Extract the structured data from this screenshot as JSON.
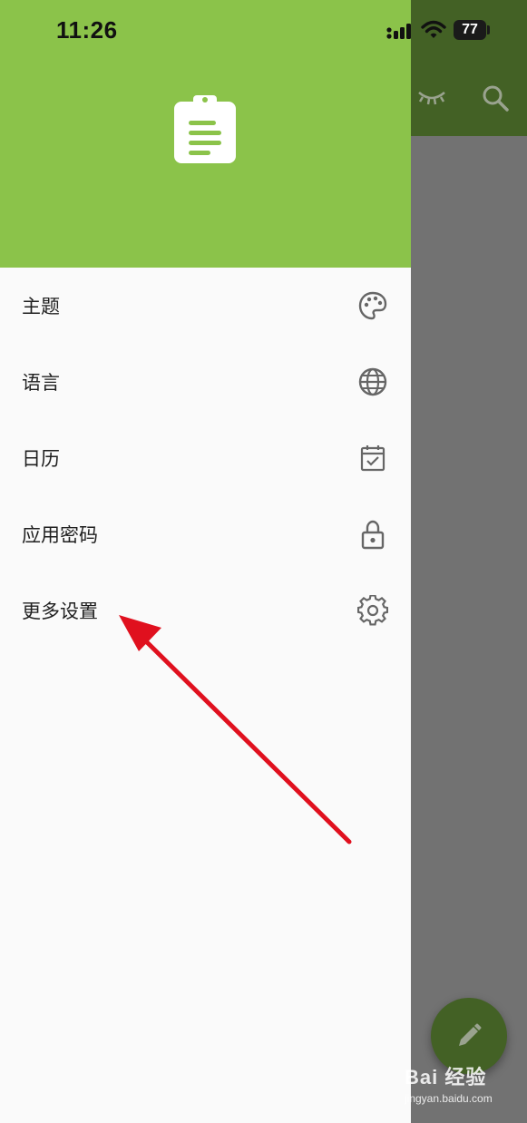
{
  "status_bar": {
    "time": "11:26",
    "battery": "77"
  },
  "menu": {
    "items": [
      {
        "label": "主题",
        "icon": "palette-icon"
      },
      {
        "label": "语言",
        "icon": "globe-icon"
      },
      {
        "label": "日历",
        "icon": "calendar-check-icon"
      },
      {
        "label": "应用密码",
        "icon": "lock-icon"
      },
      {
        "label": "更多设置",
        "icon": "gear-icon"
      }
    ]
  },
  "watermark": {
    "brand": "Bai 经验",
    "url": "jingyan.baidu.com"
  },
  "colors": {
    "drawer_header": "#8bc34a",
    "app_bar_dimmed": "#436125",
    "scrim_content": "#727272",
    "annotation_arrow": "#e0101e"
  }
}
